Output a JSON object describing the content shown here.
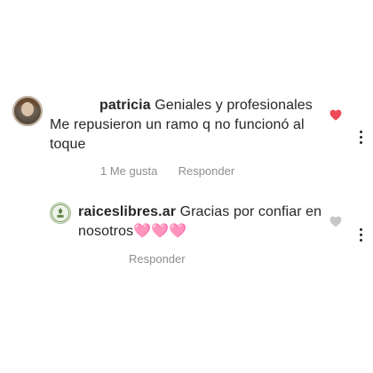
{
  "comment": {
    "username": "patricia",
    "text_first_line": "Geniales y profesionales",
    "text_line2": "Me repusieron un ramo q no funcionó al",
    "text_line3": "toque",
    "likes_label": "1 Me gusta",
    "reply_label": "Responder",
    "liked": true,
    "heart_color": "#ed4956",
    "icons": {
      "avatar": "user-avatar",
      "like": "heart-filled-icon",
      "more": "more-vertical-icon"
    }
  },
  "reply": {
    "username": "raiceslibres.ar",
    "text_first_line": "Gracias por confiar en",
    "text_line2": "nosotros🩷🩷🩷",
    "reply_label": "Responder",
    "liked": false,
    "heart_color": "#c7c7c7",
    "icons": {
      "avatar": "brand-logo-avatar",
      "like": "heart-outline-icon",
      "more": "more-vertical-icon"
    }
  }
}
